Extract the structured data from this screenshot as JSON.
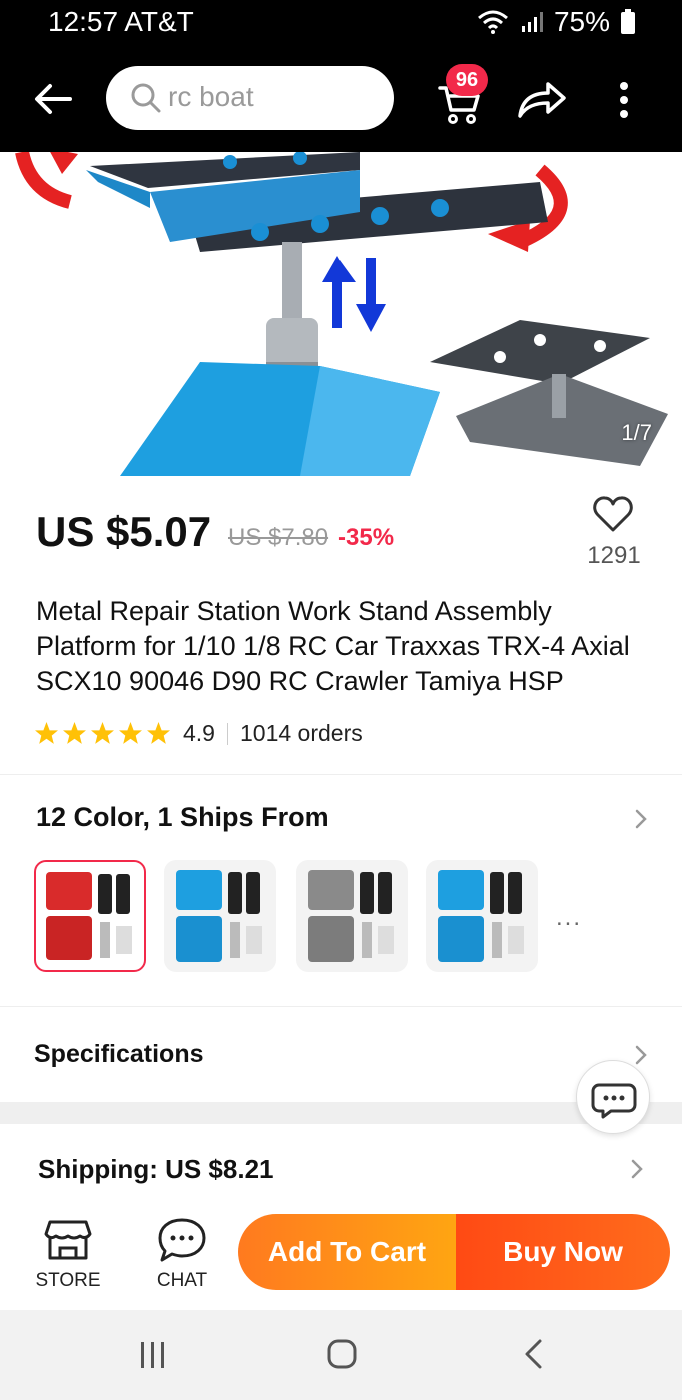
{
  "status_bar": {
    "time": "12:57 AT&T",
    "battery": "75%"
  },
  "header": {
    "search_placeholder": "rc boat",
    "cart_count": "96"
  },
  "gallery": {
    "counter": "1/7"
  },
  "product": {
    "price": "US $5.07",
    "original_price": "US $7.80",
    "discount": "-35%",
    "wishlist_count": "1291",
    "title": "Metal Repair Station Work Stand Assembly Platform for 1/10 1/8 RC Car Traxxas TRX-4 Axial SCX10 90046 D90 RC Crawler Tamiya HSP",
    "rating": "4.9",
    "stars": 5,
    "orders": "1014 orders"
  },
  "variants": {
    "title": "12 Color, 1 Ships From",
    "more": "...",
    "items": [
      {
        "color": "#d92b2b",
        "selected": true
      },
      {
        "color": "#1e9fe0",
        "selected": false
      },
      {
        "color": "#8a8a8a",
        "selected": false
      },
      {
        "color": "#1e9fe0",
        "selected": false
      }
    ]
  },
  "specifications": {
    "title": "Specifications"
  },
  "shipping": {
    "title": "Shipping: US $8.21"
  },
  "action_bar": {
    "store_label": "STORE",
    "chat_label": "CHAT",
    "add_to_cart": "Add To Cart",
    "buy_now": "Buy Now"
  },
  "colors": {
    "accent_red": "#f2294a",
    "orange": "#ff8c1a",
    "product_blue": "#1e9fe0"
  }
}
